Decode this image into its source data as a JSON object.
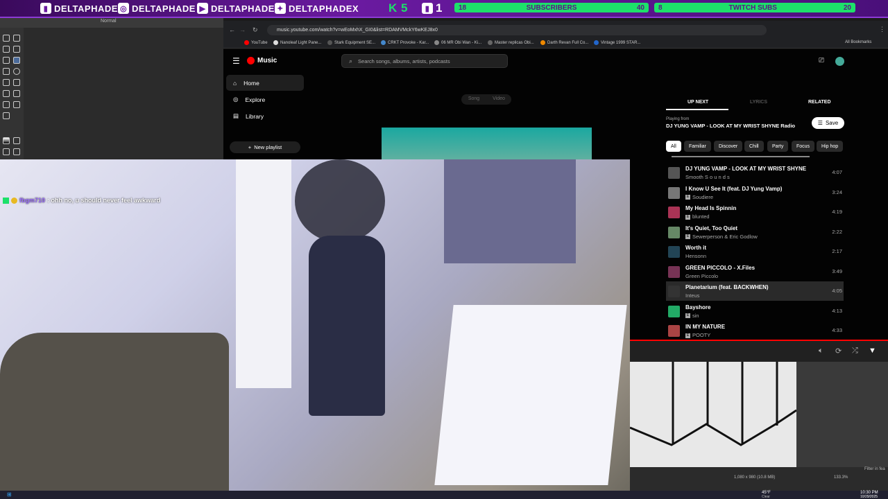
{
  "banner": {
    "names": [
      "DELTAPHADE",
      "DELTAPHADE",
      "DELTAPHADE",
      "DELTAPHADEX"
    ],
    "k_count": "K 5",
    "twitch_count": "1",
    "subs_goal_label": "SUBSCRIBERS",
    "subs_current": "18",
    "subs_target": "40",
    "twitch_goal_label": "TWITCH SUBS",
    "twitch_current": "8",
    "twitch_target": "20"
  },
  "editor": {
    "mode": "Normal"
  },
  "browser": {
    "url": "music.youtube.com/watch?v=wEoMxhX_GI0&list=RDAMVMckY6wKEJ8x0",
    "bookmarks": [
      "YouTube",
      "Nanoleaf Light Pane...",
      "Stark Equipment SE...",
      "CRKT Provoke - Kar...",
      "06 MR Obi Wan - Ki...",
      "Master replicas Obi...",
      "Darth Revan Full Co...",
      "Vintage 1999 STAR..."
    ],
    "all_bookmarks": "All Bookmarks"
  },
  "ytmusic": {
    "logo": "Music",
    "search_placeholder": "Search songs, albums, artists, podcasts",
    "nav": [
      {
        "label": "Home"
      },
      {
        "label": "Explore"
      },
      {
        "label": "Library"
      }
    ],
    "new_playlist": "New playlist",
    "toggle": {
      "song": "Song",
      "video": "Video"
    },
    "tabs": {
      "up_next": "UP NEXT",
      "lyrics": "LYRICS",
      "related": "RELATED"
    },
    "playing_from": "Playing from",
    "radio_name": "DJ YUNG VAMP - LOOK AT MY WRIST SHYNE Radio",
    "save": "Save",
    "chips": [
      "All",
      "Familiar",
      "Discover",
      "Chill",
      "Party",
      "Focus",
      "Hip hop"
    ],
    "queue": [
      {
        "title": "DJ YUNG VAMP - LOOK AT MY WRIST SHYNE",
        "artist": "Smooth S o u n d s",
        "duration": "4:07",
        "explicit": false,
        "color": "#555"
      },
      {
        "title": "I Know U See It (feat. DJ Yung Vamp)",
        "artist": "Soudiere",
        "duration": "3:24",
        "explicit": true,
        "color": "#777"
      },
      {
        "title": "My Head Is Spinnin",
        "artist": "blunted",
        "duration": "4:19",
        "explicit": true,
        "color": "#a35"
      },
      {
        "title": "It's Quiet, Too Quiet",
        "artist": "Sewerperson & Eric Godlow",
        "duration": "2:22",
        "explicit": true,
        "color": "#686"
      },
      {
        "title": "Worth it",
        "artist": "Hensonn",
        "duration": "2:17",
        "explicit": false,
        "color": "#245"
      },
      {
        "title": "GREEN PICCOLO - X.Files",
        "artist": "Green Piccolo",
        "duration": "3:49",
        "explicit": false,
        "color": "#735"
      },
      {
        "title": "Planetarium (feat. BACKWHEN)",
        "artist": "Inteus",
        "duration": "4:05",
        "explicit": false,
        "color": "#333"
      },
      {
        "title": "Bayshore",
        "artist": "sin",
        "duration": "4:13",
        "explicit": true,
        "color": "#2a6"
      },
      {
        "title": "IN MY NATURE",
        "artist": "POOTY",
        "duration": "4:33",
        "explicit": true,
        "color": "#a44"
      }
    ]
  },
  "chat": {
    "user": "fbgm710",
    "message": ": ohh no, u should never feel awkward"
  },
  "status": {
    "dimensions": "1,080 x 980 (10.8 MB)",
    "zoom": "133.3%",
    "filter": "Filter in fea",
    "weather_temp": "45°F",
    "weather_desc": "Clear",
    "time": "10:30 PM",
    "date": "10/29/2025"
  }
}
